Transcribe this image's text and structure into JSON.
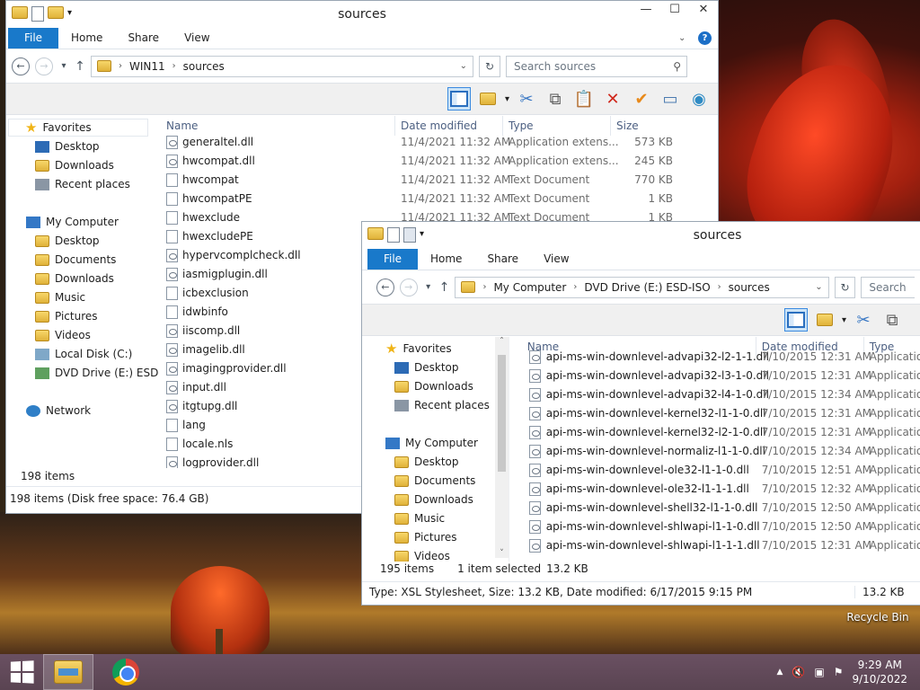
{
  "desktop": {
    "recycle_bin_label": "Recycle Bin"
  },
  "window1": {
    "title": "sources",
    "tabs": [
      "File",
      "Home",
      "Share",
      "View"
    ],
    "breadcrumb": [
      "WIN11",
      "sources"
    ],
    "search_placeholder": "Search sources",
    "nav": {
      "favorites": "Favorites",
      "desktop": "Desktop",
      "downloads": "Downloads",
      "recent": "Recent places",
      "my_computer": "My Computer",
      "desktop2": "Desktop",
      "documents": "Documents",
      "downloads2": "Downloads",
      "music": "Music",
      "pictures": "Pictures",
      "videos": "Videos",
      "local_disk": "Local Disk (C:)",
      "dvd": "DVD Drive (E:) ESD-IS",
      "network": "Network"
    },
    "columns": {
      "name": "Name",
      "date": "Date modified",
      "type": "Type",
      "size": "Size"
    },
    "files": [
      {
        "name": "generaltel.dll",
        "date": "11/4/2021 11:32 AM",
        "type": "Application extens...",
        "size": "573 KB"
      },
      {
        "name": "hwcompat.dll",
        "date": "11/4/2021 11:32 AM",
        "type": "Application extens...",
        "size": "245 KB"
      },
      {
        "name": "hwcompat",
        "date": "11/4/2021 11:32 AM",
        "type": "Text Document",
        "size": "770 KB"
      },
      {
        "name": "hwcompatPE",
        "date": "11/4/2021 11:32 AM",
        "type": "Text Document",
        "size": "1 KB"
      },
      {
        "name": "hwexclude",
        "date": "11/4/2021 11:32 AM",
        "type": "Text Document",
        "size": "1 KB"
      },
      {
        "name": "hwexcludePE",
        "date": "",
        "type": "",
        "size": ""
      },
      {
        "name": "hypervcomplcheck.dll",
        "date": "",
        "type": "",
        "size": ""
      },
      {
        "name": "iasmigplugin.dll",
        "date": "",
        "type": "",
        "size": ""
      },
      {
        "name": "icbexclusion",
        "date": "",
        "type": "",
        "size": ""
      },
      {
        "name": "idwbinfo",
        "date": "",
        "type": "",
        "size": ""
      },
      {
        "name": "iiscomp.dll",
        "date": "",
        "type": "",
        "size": ""
      },
      {
        "name": "imagelib.dll",
        "date": "",
        "type": "",
        "size": ""
      },
      {
        "name": "imagingprovider.dll",
        "date": "",
        "type": "",
        "size": ""
      },
      {
        "name": "input.dll",
        "date": "",
        "type": "",
        "size": ""
      },
      {
        "name": "itgtupg.dll",
        "date": "",
        "type": "",
        "size": ""
      },
      {
        "name": "lang",
        "date": "",
        "type": "",
        "size": ""
      },
      {
        "name": "locale.nls",
        "date": "",
        "type": "",
        "size": ""
      },
      {
        "name": "logprovider.dll",
        "date": "",
        "type": "",
        "size": ""
      }
    ],
    "item_count": "198 items",
    "status_bar": "198 items (Disk free space: 76.4 GB)"
  },
  "window2": {
    "title": "sources",
    "tabs": [
      "File",
      "Home",
      "Share",
      "View"
    ],
    "breadcrumb": [
      "My Computer",
      "DVD Drive (E:) ESD-ISO",
      "sources"
    ],
    "search_placeholder": "Search",
    "nav": {
      "favorites": "Favorites",
      "desktop": "Desktop",
      "downloads": "Downloads",
      "recent": "Recent places",
      "my_computer": "My Computer",
      "desktop2": "Desktop",
      "documents": "Documents",
      "downloads2": "Downloads",
      "music": "Music",
      "pictures": "Pictures",
      "videos": "Videos"
    },
    "columns": {
      "name": "Name",
      "date": "Date modified",
      "type": "Type"
    },
    "files": [
      {
        "name": "api-ms-win-downlevel-advapi32-l2-1-1.dll",
        "date": "7/10/2015 12:31 AM",
        "type": "Application"
      },
      {
        "name": "api-ms-win-downlevel-advapi32-l3-1-0.dll",
        "date": "7/10/2015 12:31 AM",
        "type": "Application"
      },
      {
        "name": "api-ms-win-downlevel-advapi32-l4-1-0.dll",
        "date": "7/10/2015 12:34 AM",
        "type": "Application"
      },
      {
        "name": "api-ms-win-downlevel-kernel32-l1-1-0.dll",
        "date": "7/10/2015 12:31 AM",
        "type": "Application"
      },
      {
        "name": "api-ms-win-downlevel-kernel32-l2-1-0.dll",
        "date": "7/10/2015 12:31 AM",
        "type": "Application"
      },
      {
        "name": "api-ms-win-downlevel-normaliz-l1-1-0.dll",
        "date": "7/10/2015 12:34 AM",
        "type": "Application"
      },
      {
        "name": "api-ms-win-downlevel-ole32-l1-1-0.dll",
        "date": "7/10/2015 12:51 AM",
        "type": "Application"
      },
      {
        "name": "api-ms-win-downlevel-ole32-l1-1-1.dll",
        "date": "7/10/2015 12:32 AM",
        "type": "Application"
      },
      {
        "name": "api-ms-win-downlevel-shell32-l1-1-0.dll",
        "date": "7/10/2015 12:50 AM",
        "type": "Application"
      },
      {
        "name": "api-ms-win-downlevel-shlwapi-l1-1-0.dll",
        "date": "7/10/2015 12:50 AM",
        "type": "Application"
      },
      {
        "name": "api-ms-win-downlevel-shlwapi-l1-1-1.dll",
        "date": "7/10/2015 12:31 AM",
        "type": "Application"
      }
    ],
    "item_count": "195 items",
    "selected": "1 item selected",
    "selected_size": "13.2 KB",
    "status_bar": "Type: XSL Stylesheet, Size: 13.2 KB, Date modified: 6/17/2015 9:15 PM",
    "status_size": "13.2 KB"
  },
  "taskbar": {
    "time": "9:29 AM",
    "date": "9/10/2022"
  }
}
